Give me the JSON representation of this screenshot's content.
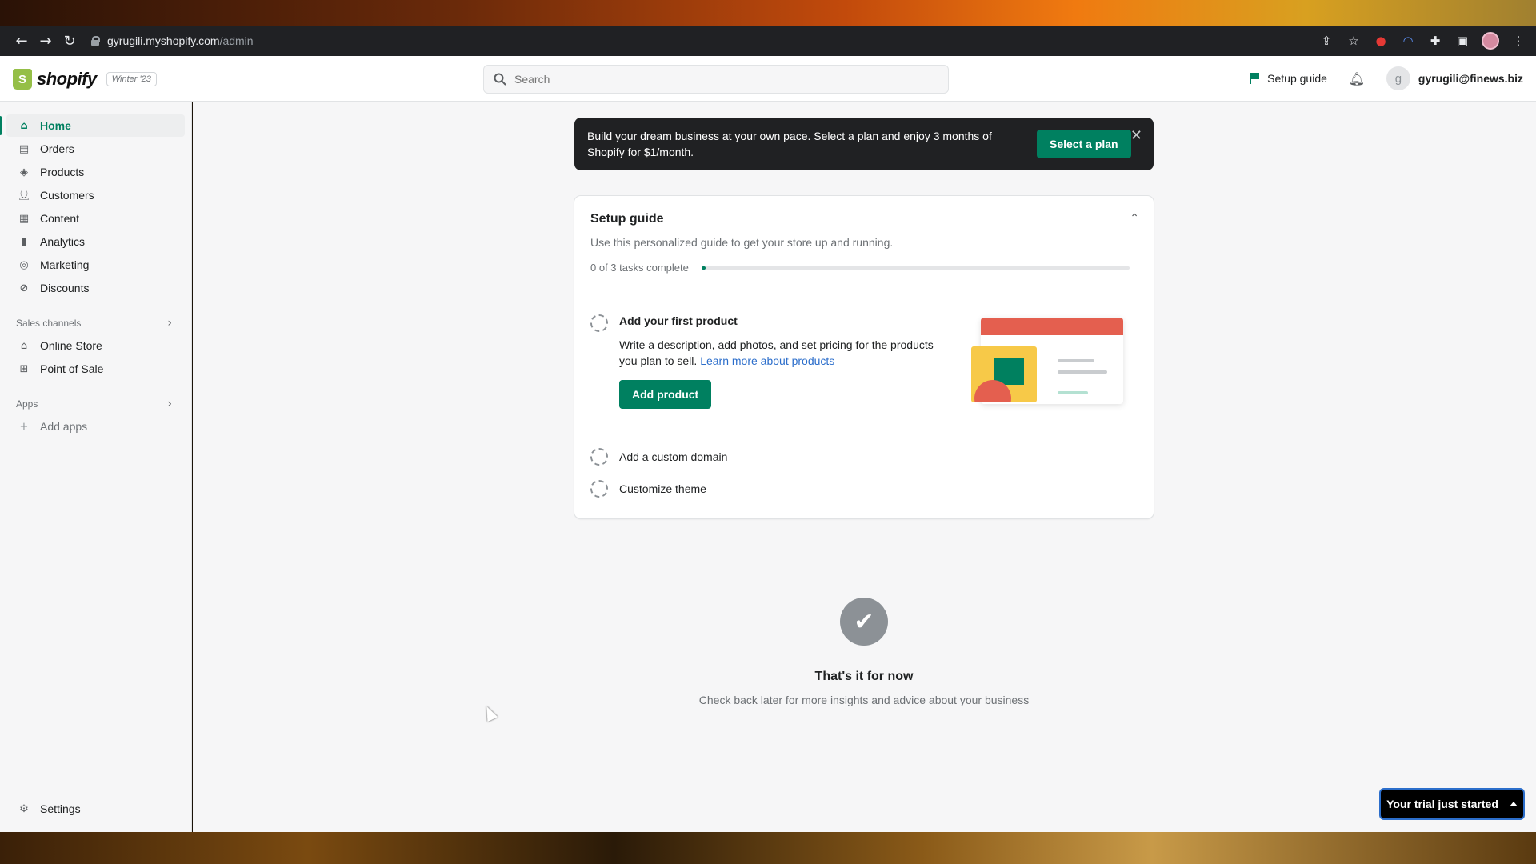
{
  "browser": {
    "url_host": "gyrugili.myshopify.com",
    "url_path": "/admin",
    "icons": [
      "back-icon",
      "forward-icon",
      "reload-icon",
      "lock-icon",
      "share-icon",
      "star-icon",
      "extension-icon",
      "puzzle-icon",
      "sidepanel-icon",
      "profile-avatar",
      "kebab-menu-icon"
    ]
  },
  "header": {
    "brand": "shopify",
    "edition": "Winter '23",
    "search_placeholder": "Search",
    "setup_guide_label": "Setup guide",
    "account_initial": "g",
    "account_email": "gyrugili@finews.biz"
  },
  "sidebar": {
    "items": [
      {
        "label": "Home",
        "icon": "home-icon",
        "active": true
      },
      {
        "label": "Orders",
        "icon": "orders-icon"
      },
      {
        "label": "Products",
        "icon": "tag-icon"
      },
      {
        "label": "Customers",
        "icon": "person-icon"
      },
      {
        "label": "Content",
        "icon": "content-icon"
      },
      {
        "label": "Analytics",
        "icon": "bar-chart-icon"
      },
      {
        "label": "Marketing",
        "icon": "target-icon"
      },
      {
        "label": "Discounts",
        "icon": "discount-icon"
      }
    ],
    "sales_channels_label": "Sales channels",
    "channels": [
      {
        "label": "Online Store",
        "icon": "store-icon"
      },
      {
        "label": "Point of Sale",
        "icon": "pos-icon"
      }
    ],
    "apps_label": "Apps",
    "add_apps_label": "Add apps",
    "settings_label": "Settings"
  },
  "banner": {
    "text": "Build your dream business at your own pace. Select a plan and enjoy 3 months of Shopify for $1/month.",
    "button_label": "Select a plan"
  },
  "setup_guide": {
    "title": "Setup guide",
    "subtitle": "Use this personalized guide to get your store up and running.",
    "progress_text": "0 of 3 tasks complete",
    "progress_fraction": 0,
    "tasks": [
      {
        "title": "Add your first product",
        "description": "Write a description, add photos, and set pricing for the products you plan to sell.",
        "link_label": "Learn more about products",
        "button_label": "Add product"
      },
      {
        "title": "Add a custom domain"
      },
      {
        "title": "Customize theme"
      }
    ]
  },
  "empty_state": {
    "title": "That's it for now",
    "subtitle": "Check back later for more insights and advice about your business"
  },
  "trial_button_label": "Your trial just started",
  "colors": {
    "accent": "#008060",
    "link": "#2c6ecb",
    "banner_bg": "#202123"
  }
}
